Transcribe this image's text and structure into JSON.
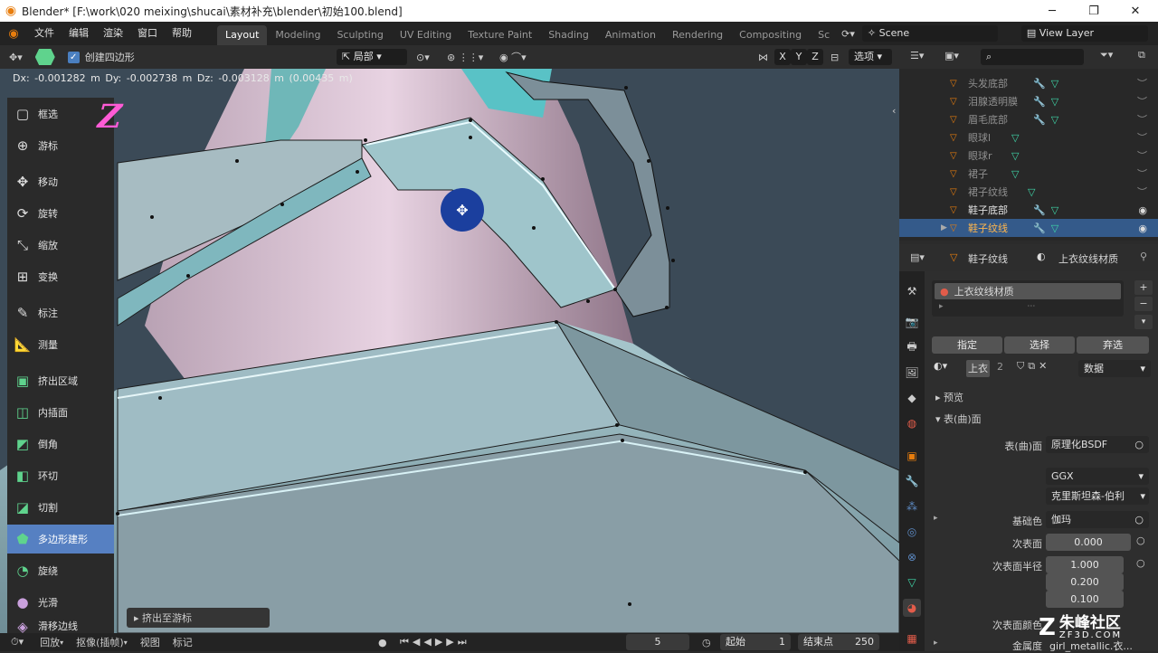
{
  "window": {
    "title": "Blender* [F:\\work\\020 meixing\\shucai\\素材补充\\blender\\初始100.blend]",
    "minimize": "─",
    "maximize": "❐",
    "close": "✕"
  },
  "menu": [
    "文件",
    "编辑",
    "渲染",
    "窗口",
    "帮助"
  ],
  "workspaces": [
    "Layout",
    "Modeling",
    "Sculpting",
    "UV Editing",
    "Texture Paint",
    "Shading",
    "Animation",
    "Rendering",
    "Compositing",
    "Sc"
  ],
  "scene": {
    "name": "Scene",
    "view_layer": "View Layer"
  },
  "viewport_header": {
    "create_quad_label": "创建四边形",
    "orientation": "局部",
    "axes": [
      "X",
      "Y",
      "Z"
    ],
    "options": "选项"
  },
  "tool_info": "Dx: -0.001282 m   Dy: -0.002738 m   Dz: -0.003128 m (0.00435 m)",
  "annotation": "Z",
  "tools": [
    {
      "label": "框选",
      "icon": "▢"
    },
    {
      "label": "游标",
      "icon": "⊕"
    },
    {
      "label": "移动",
      "icon": "✥"
    },
    {
      "label": "旋转",
      "icon": "⟳"
    },
    {
      "label": "缩放",
      "icon": "⤡"
    },
    {
      "label": "变换",
      "icon": "⊞"
    },
    {
      "label": "标注",
      "icon": "✎"
    },
    {
      "label": "测量",
      "icon": "📐"
    },
    {
      "label": "挤出区域",
      "icon": "▣"
    },
    {
      "label": "内插面",
      "icon": "◫"
    },
    {
      "label": "倒角",
      "icon": "◩"
    },
    {
      "label": "环切",
      "icon": "◧"
    },
    {
      "label": "切割",
      "icon": "◪"
    },
    {
      "label": "多边形建形",
      "icon": "⬟"
    },
    {
      "label": "旋绕",
      "icon": "◔"
    },
    {
      "label": "光滑",
      "icon": "●"
    },
    {
      "label": "滑移边线",
      "icon": "◈"
    }
  ],
  "extrude_panel": "挤出至游标",
  "timeline": {
    "playback": "回放",
    "keying": "抠像(插帧)",
    "view": "视图",
    "marker": "标记",
    "current_frame": "5",
    "start_label": "起始",
    "start": "1",
    "end_label": "结束点",
    "end": "250"
  },
  "outliner": {
    "rows": [
      {
        "name": "头发底部"
      },
      {
        "name": "泪腺透明膜"
      },
      {
        "name": "眉毛底部"
      },
      {
        "name": "眼球l"
      },
      {
        "name": "眼球r"
      },
      {
        "name": "裙子"
      },
      {
        "name": "裙子纹线"
      },
      {
        "name": "鞋子底部"
      },
      {
        "name": "鞋子纹线"
      }
    ]
  },
  "properties": {
    "object": "鞋子纹线",
    "material": "上衣纹线材质",
    "slot": "上衣纹线材质",
    "assign": "指定",
    "select": "选择",
    "deselect": "弃选",
    "mat_short": "上衣",
    "users": "2",
    "link": "数据",
    "preview": "预览",
    "surface_section": "表(曲)面",
    "surface_label": "表(曲)面",
    "surface_value": "原理化BSDF",
    "distribution": "GGX",
    "subsurface_method": "克里斯坦森-伯利",
    "base_color_label": "基础色",
    "base_color_value": "伽玛",
    "subsurface_label": "次表面",
    "subsurface_value": "0.000",
    "subsurface_radius_label": "次表面半径",
    "radius": [
      "1.000",
      "0.200",
      "0.100"
    ],
    "subsurface_color_label": "次表面颜色",
    "metallic_label": "金属度",
    "metallic_value": "girl_metallic.衣..."
  },
  "watermark": {
    "name": "朱峰社区",
    "url": "ZF3D.COM"
  }
}
